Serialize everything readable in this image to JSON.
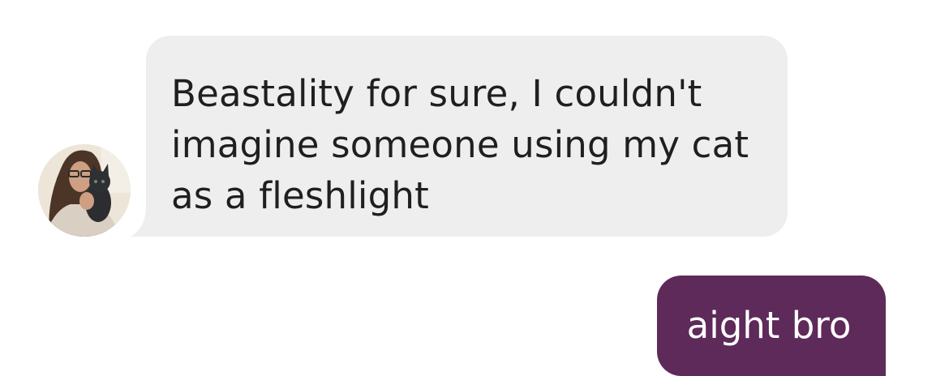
{
  "conversation": {
    "incoming": {
      "text": "Beastality for sure, I couldn't imagine someone using my cat as a fleshlight",
      "bubble_color": "#eeeeee"
    },
    "outgoing": {
      "text": "aight bro",
      "bubble_color": "#5e2a5a"
    }
  }
}
